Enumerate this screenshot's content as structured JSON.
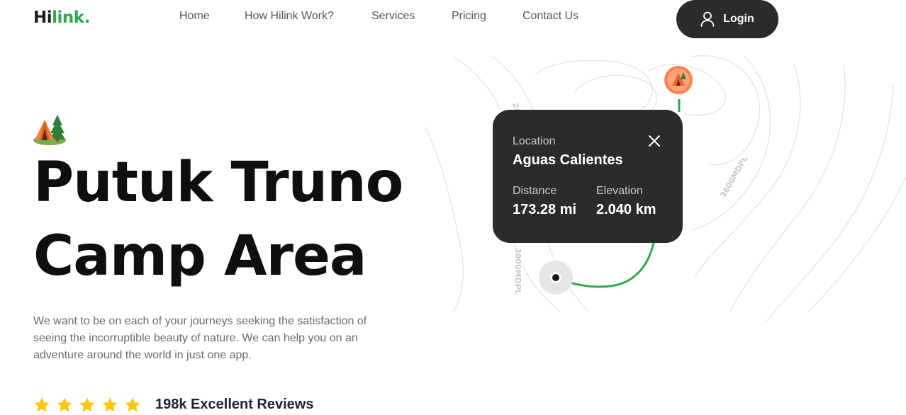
{
  "header": {
    "logo_prefix": "Hi",
    "logo_suffix": "link.",
    "nav": [
      "Home",
      "How Hilink Work?",
      "Services",
      "Pricing",
      "Contact Us"
    ],
    "login_label": "Login"
  },
  "hero": {
    "title_line1": "Putuk Truno",
    "title_line2": "Camp Area",
    "description": "We want to be on each of your journeys seeking the satisfaction of seeing the incorruptible beauty of nature. We can help you on an adventure around the world in just one app.",
    "rating_stars": 5,
    "reviews_label": "198k Excellent Reviews"
  },
  "map": {
    "contour_labels": [
      "2400MDPL",
      "3000MDPL",
      "3600MDPL"
    ]
  },
  "location_card": {
    "location_label": "Location",
    "location_value": "Aguas Calientes",
    "distance_label": "Distance",
    "distance_value": "173.28 mi",
    "elevation_label": "Elevation",
    "elevation_value": "2.040 km"
  },
  "colors": {
    "brand_green": "#2fa84f",
    "dark": "#292c2b",
    "star": "#f9c80e",
    "pin_orange": "#ff7f4a"
  },
  "icons": {
    "login": "user-icon",
    "camp": "camp-tent-icon",
    "close": "close-icon",
    "star": "star-icon"
  }
}
